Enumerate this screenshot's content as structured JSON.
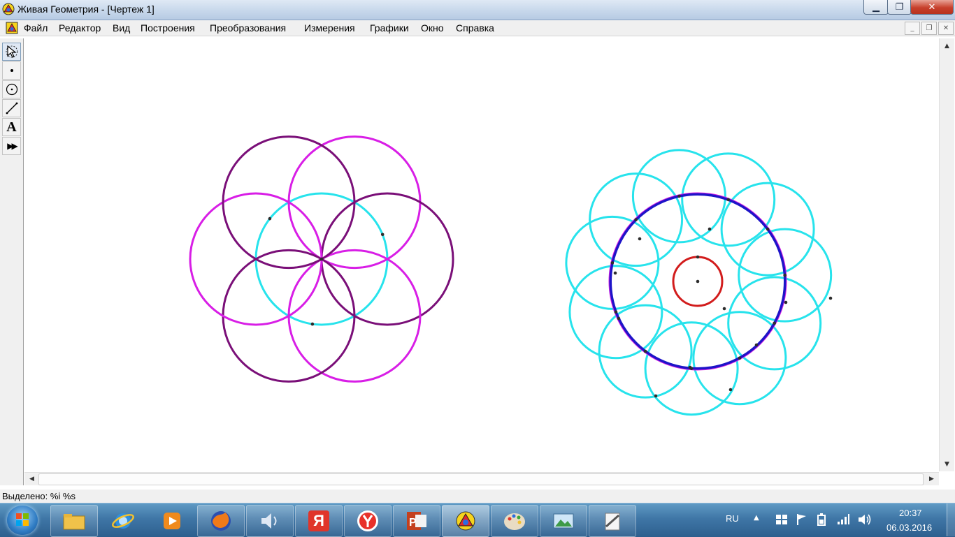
{
  "window": {
    "title": "Живая Геометрия - [Чертеж 1]",
    "minimize_glyph": "▁",
    "maximize_glyph": "❐",
    "close_glyph": "✕"
  },
  "menu": {
    "items": [
      "Файл",
      "Редактор",
      "Вид",
      "Построения",
      "Преобразования",
      "Измерения",
      "Графики",
      "Окно",
      "Справка"
    ],
    "mdi_minimize": "_",
    "mdi_restore": "❐",
    "mdi_close": "✕"
  },
  "tools": [
    {
      "name": "selection-arrow-tool-icon"
    },
    {
      "name": "point-tool-icon"
    },
    {
      "name": "compass-tool-icon"
    },
    {
      "name": "straightedge-tool-icon"
    },
    {
      "name": "text-tool-icon",
      "glyph": "A"
    },
    {
      "name": "custom-tool-icon",
      "glyph": "▶▶"
    }
  ],
  "status": {
    "text": "Выделено: %i %s"
  },
  "taskbar": {
    "apps": [
      "file-explorer",
      "internet-explorer",
      "media-player",
      "firefox",
      "volume-app",
      "yandex",
      "yandex-browser",
      "powerpoint",
      "geometers-sketchpad",
      "paint",
      "picture-viewer",
      "notepad-tool"
    ],
    "yandex_letter": "Я",
    "language": "RU",
    "time": "20:37",
    "date": "06.03.2016"
  },
  "colors": {
    "magenta": "#d81ee6",
    "purple": "#7a0f78",
    "cyan": "#27e3ec",
    "blue": "#1e14c8",
    "red": "#d21c1c",
    "point": "#2c2c2c"
  }
}
